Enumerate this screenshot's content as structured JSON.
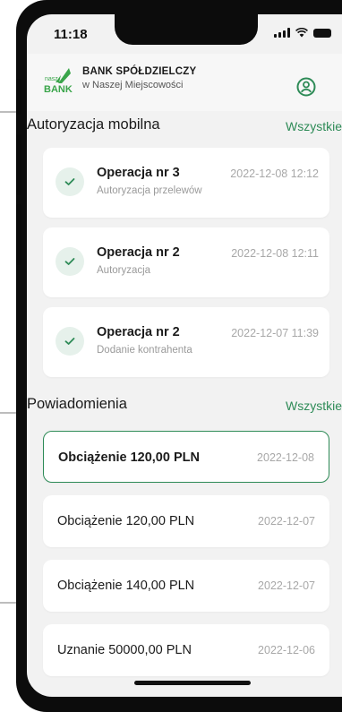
{
  "status_bar": {
    "time": "11:18"
  },
  "header": {
    "bank_name": "BANK SPÓŁDZIELCZY",
    "bank_subtitle": "w Naszej Miejscowości",
    "logo_top": "nasz",
    "logo_bottom": "BANK"
  },
  "mobile_auth": {
    "title": "Autoryzacja mobilna",
    "all_label": "Wszystkie",
    "items": [
      {
        "title": "Operacja nr 3",
        "subtitle": "Autoryzacja przelewów",
        "date": "2022-12-08 12:12"
      },
      {
        "title": "Operacja nr 2",
        "subtitle": "Autoryzacja",
        "date": "2022-12-08 12:11"
      },
      {
        "title": "Operacja nr 2",
        "subtitle": "Dodanie kontrahenta",
        "date": "2022-12-07 11:39"
      }
    ]
  },
  "notifications": {
    "title": "Powiadomienia",
    "all_label": "Wszystkie",
    "items": [
      {
        "title": "Obciążenie 120,00 PLN",
        "date": "2022-12-08"
      },
      {
        "title": "Obciążenie 120,00 PLN",
        "date": "2022-12-07"
      },
      {
        "title": "Obciążenie 140,00 PLN",
        "date": "2022-12-07"
      },
      {
        "title": "Uznanie 50000,00 PLN",
        "date": "2022-12-06"
      }
    ]
  },
  "colors": {
    "accent": "#2e8b57",
    "logo_green": "#3aa54a",
    "background": "#f2f2f2"
  }
}
